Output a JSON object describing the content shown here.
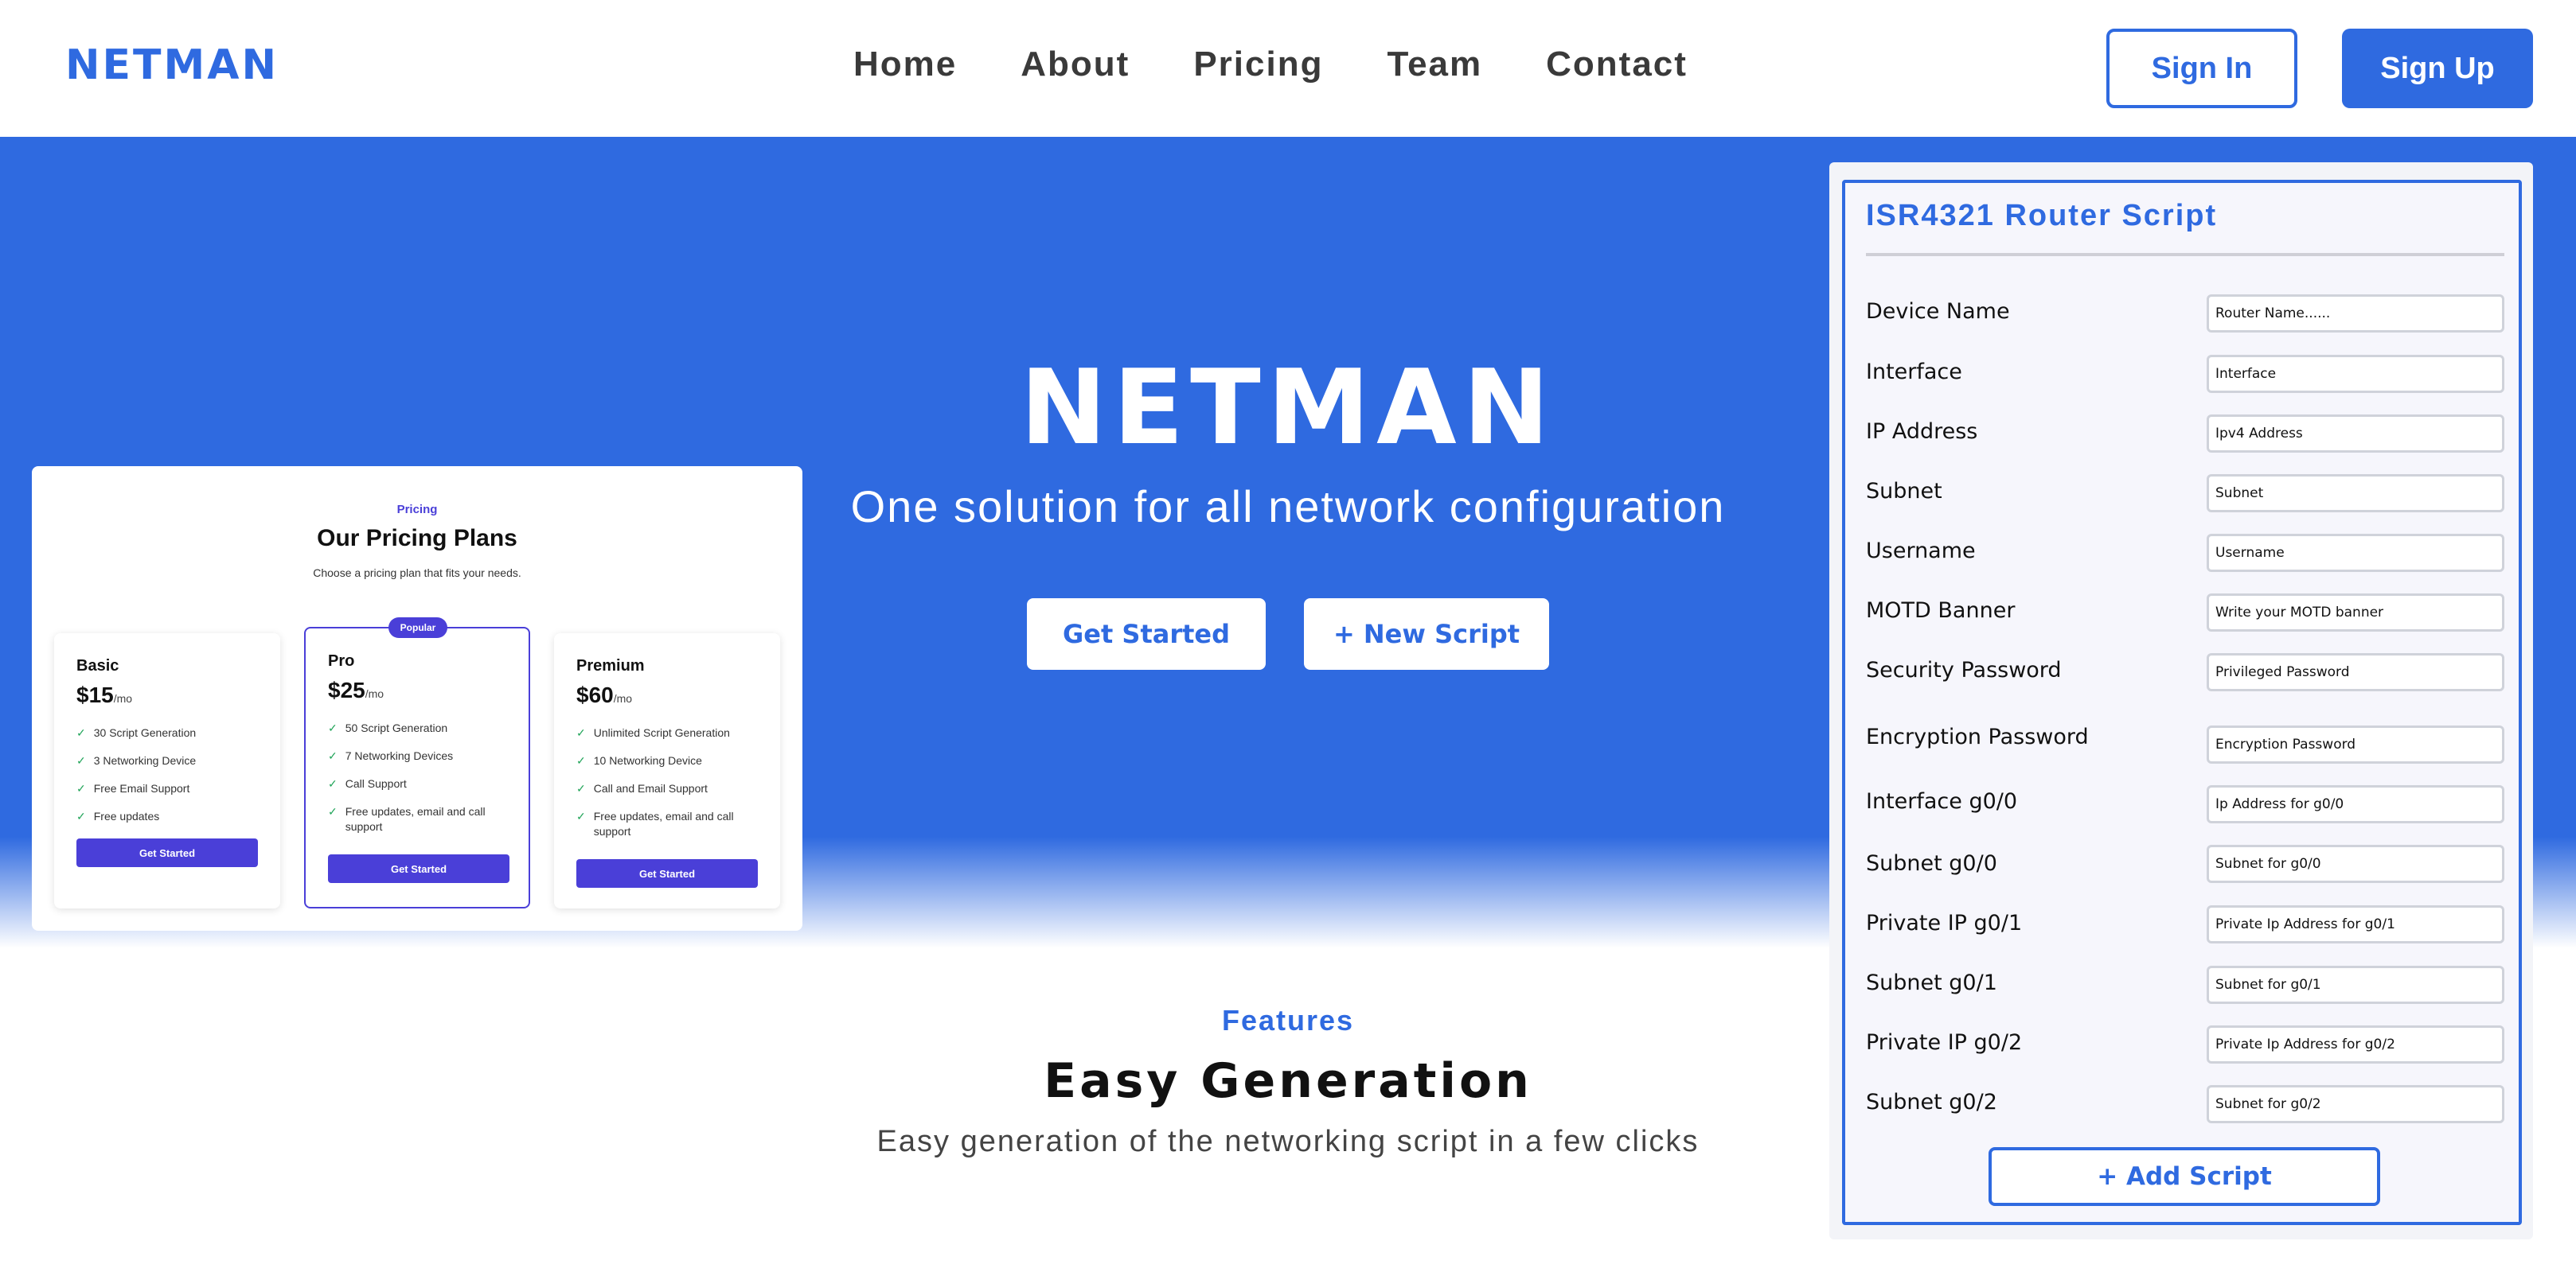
{
  "nav": {
    "logo": "NETMAN",
    "links": [
      "Home",
      "About",
      "Pricing",
      "Team",
      "Contact"
    ],
    "sign_in": "Sign In",
    "sign_up": "Sign Up"
  },
  "colors": {
    "primary": "#2f6ae0",
    "pricing_accent": "#4a3fd8",
    "check": "#22a55a"
  },
  "pricing_preview": {
    "kicker": "Pricing",
    "title": "Our Pricing Plans",
    "subtitle": "Choose a pricing plan that fits your needs.",
    "popular_badge": "Popular",
    "plans": [
      {
        "name": "Basic",
        "price": "$15",
        "period": "/mo",
        "features": [
          "30 Script Generation",
          "3 Networking Device",
          "Free Email Support",
          "Free updates"
        ],
        "button": "Get Started"
      },
      {
        "name": "Pro",
        "price": "$25",
        "period": "/mo",
        "features": [
          "50 Script Generation",
          "7 Networking Devices",
          "Call Support",
          "Free updates, email and call support"
        ],
        "button": "Get Started"
      },
      {
        "name": "Premium",
        "price": "$60",
        "period": "/mo",
        "features": [
          "Unlimited Script Generation",
          "10 Networking Device",
          "Call and Email Support",
          "Free updates, email and call support"
        ],
        "button": "Get Started"
      }
    ]
  },
  "hero": {
    "title": "NETMAN",
    "subtitle": "One solution for all network configuration",
    "get_started": "Get Started",
    "new_script": "+ New Script"
  },
  "features": {
    "kicker": "Features",
    "title": "Easy Generation",
    "subtitle": "Easy generation of the networking script in a few clicks"
  },
  "router_form": {
    "title": "ISR4321 Router Script",
    "fields": [
      {
        "label": "Device Name",
        "placeholder": "Router Name......"
      },
      {
        "label": "Interface",
        "placeholder": "Interface"
      },
      {
        "label": "IP Address",
        "placeholder": "Ipv4 Address"
      },
      {
        "label": "Subnet",
        "placeholder": "Subnet"
      },
      {
        "label": "Username",
        "placeholder": "Username"
      },
      {
        "label": "MOTD Banner",
        "placeholder": "Write your MOTD banner"
      },
      {
        "label": "Security Password",
        "placeholder": "Privileged Password"
      },
      {
        "label": "Encryption Password",
        "placeholder": "Encryption Password"
      },
      {
        "label": "Interface g0/0",
        "placeholder": "Ip Address for g0/0"
      },
      {
        "label": "Subnet g0/0",
        "placeholder": "Subnet for g0/0"
      },
      {
        "label": "Private IP g0/1",
        "placeholder": "Private Ip Address for g0/1"
      },
      {
        "label": "Subnet g0/1",
        "placeholder": "Subnet for g0/1"
      },
      {
        "label": "Private IP g0/2",
        "placeholder": "Private Ip Address for g0/2"
      },
      {
        "label": "Subnet g0/2",
        "placeholder": "Subnet for g0/2"
      }
    ],
    "add_button": "+ Add Script"
  }
}
